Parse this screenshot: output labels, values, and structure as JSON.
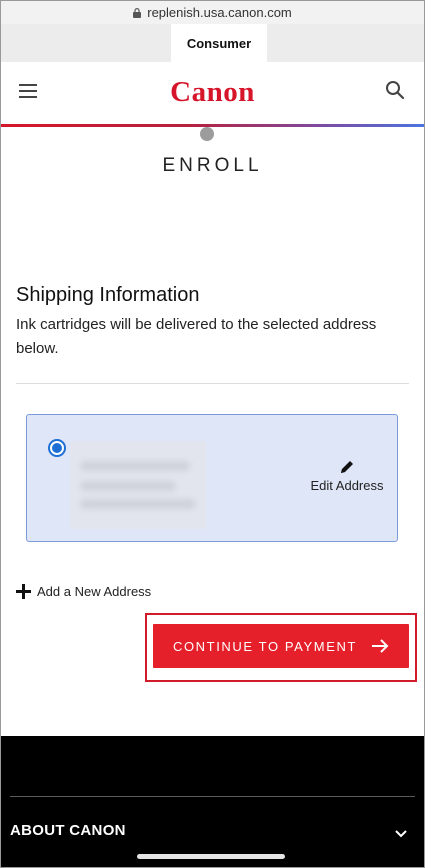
{
  "browser": {
    "url": "replenish.usa.canon.com"
  },
  "tabs": {
    "active_label": "Consumer"
  },
  "header": {
    "logo_text": "Canon"
  },
  "page": {
    "step_title": "ENROLL",
    "section_title": "Shipping Information",
    "section_description": "Ink cartridges will be delivered to the selected address below."
  },
  "address": {
    "selected": true,
    "edit_label": "Edit Address"
  },
  "actions": {
    "add_address_label": "Add a New Address",
    "continue_label": "CONTINUE TO PAYMENT"
  },
  "footer": {
    "about_label": "ABOUT CANON"
  },
  "colors": {
    "brand_red": "#d6152b",
    "button_red": "#e5202a",
    "radio_blue": "#1d6fd6",
    "card_bg": "#dfe6f7"
  },
  "icons": [
    "lock-icon",
    "menu-icon",
    "search-icon",
    "edit-icon",
    "plus-icon",
    "arrow-right-icon",
    "chevron-down-icon"
  ]
}
